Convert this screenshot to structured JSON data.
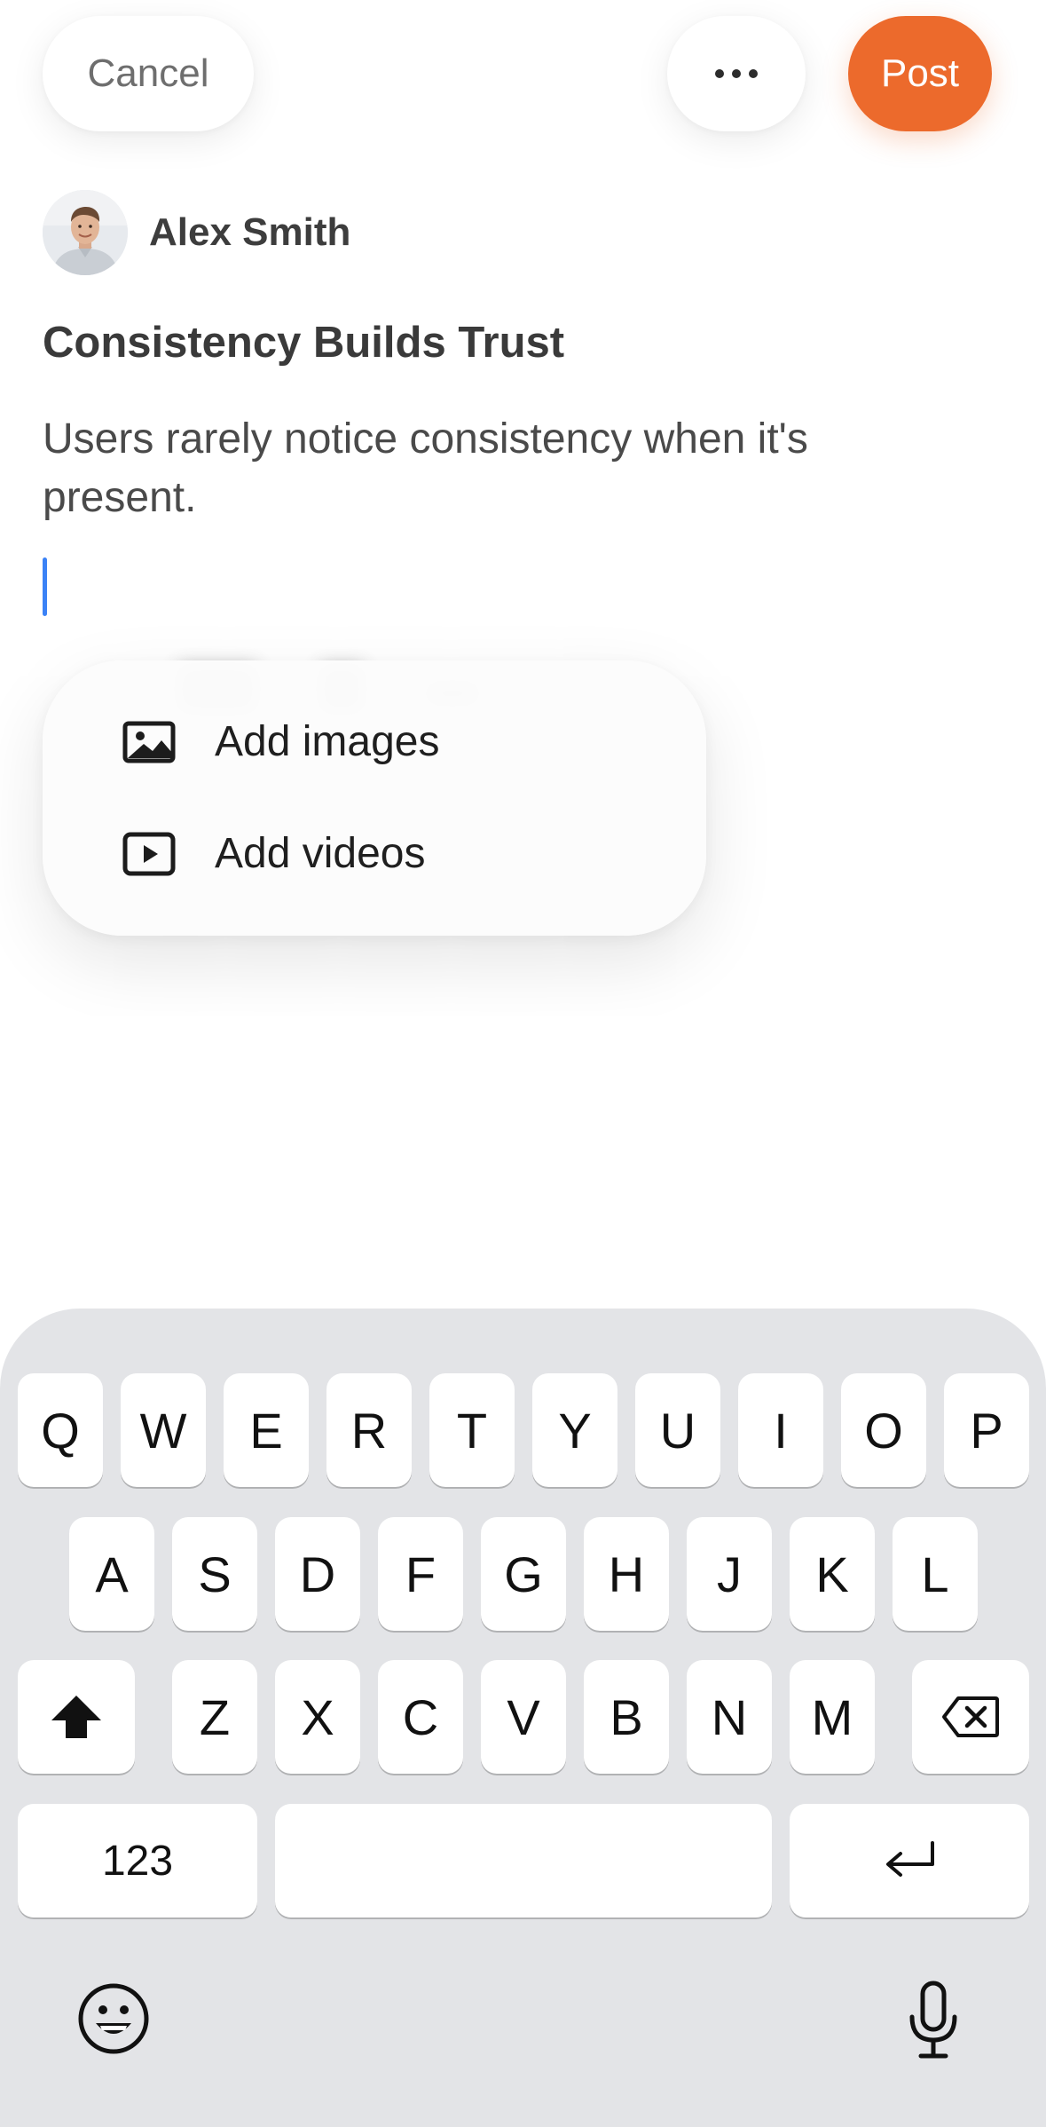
{
  "header": {
    "cancel_label": "Cancel",
    "more_icon": "ellipsis-icon",
    "post_label": "Post",
    "accent_color": "#ec6a2c"
  },
  "author": {
    "name": "Alex Smith",
    "avatar_icon": "user-avatar"
  },
  "post": {
    "title": "Consistency Builds Trust",
    "body": "Users rarely notice consistency when it's present."
  },
  "attach_menu": {
    "items": [
      {
        "label": "Add images",
        "icon": "image-icon"
      },
      {
        "label": "Add videos",
        "icon": "video-icon"
      }
    ]
  },
  "keyboard": {
    "row1": [
      "Q",
      "W",
      "E",
      "R",
      "T",
      "Y",
      "U",
      "I",
      "O",
      "P"
    ],
    "row2": [
      "A",
      "S",
      "D",
      "F",
      "G",
      "H",
      "J",
      "K",
      "L"
    ],
    "row3": [
      "Z",
      "X",
      "C",
      "V",
      "B",
      "N",
      "M"
    ],
    "numbers_label": "123",
    "shift_icon": "shift-icon",
    "backspace_icon": "backspace-icon",
    "return_icon": "return-icon",
    "emoji_icon": "emoji-icon",
    "mic_icon": "microphone-icon"
  }
}
